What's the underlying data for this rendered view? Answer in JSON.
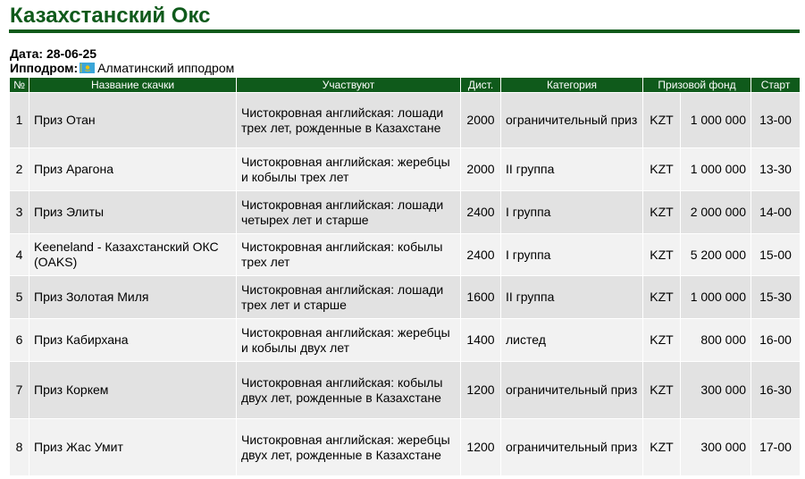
{
  "page": {
    "title": "Казахстанский Окс",
    "date_label": "Дата:",
    "date_value": "28-06-25",
    "hippodrome_label": "Ипподром:",
    "hippodrome_value": "Алматинский ипподром",
    "hippodrome_flag_icon": "kazakhstan-flag-icon",
    "colors": {
      "accent": "#0f5a1b",
      "row_odd": "#e2e2e2",
      "row_even": "#f2f2f2",
      "flag_blue": "#3ba6d8",
      "flag_gold": "#f2c200"
    }
  },
  "table": {
    "headers": {
      "num": "№",
      "name": "Название скачки",
      "participants": "Участвуют",
      "distance": "Дист.",
      "category": "Категория",
      "prize": "Призовой фонд",
      "start": "Старт"
    },
    "rows": [
      {
        "num": "1",
        "name": "Приз Отан",
        "participants": "Чистокровная английская: лошади трех лет, рожденные в Казахстане",
        "distance": "2000",
        "category": "ограничительный приз",
        "currency": "KZT",
        "prize": "1 000 000",
        "start": "13-00"
      },
      {
        "num": "2",
        "name": "Приз Арагона",
        "participants": "Чистокровная английская: жеребцы и кобылы трех лет",
        "distance": "2000",
        "category": "II группа",
        "currency": "KZT",
        "prize": "1 000 000",
        "start": "13-30"
      },
      {
        "num": "3",
        "name": "Приз Элиты",
        "participants": "Чистокровная английская: лошади четырех лет и старше",
        "distance": "2400",
        "category": "I группа",
        "currency": "KZT",
        "prize": "2 000 000",
        "start": "14-00"
      },
      {
        "num": "4",
        "name": "Keeneland - Казахстанский ОКС (OAKS)",
        "participants": "Чистокровная английская: кобылы трех лет",
        "distance": "2400",
        "category": "I группа",
        "currency": "KZT",
        "prize": "5 200 000",
        "start": "15-00"
      },
      {
        "num": "5",
        "name": "Приз Золотая Миля",
        "participants": "Чистокровная английская: лошади трех лет и старше",
        "distance": "1600",
        "category": "II группа",
        "currency": "KZT",
        "prize": "1 000 000",
        "start": "15-30"
      },
      {
        "num": "6",
        "name": "Приз Кабирхана",
        "participants": "Чистокровная английская: жеребцы и кобылы двух лет",
        "distance": "1400",
        "category": "листед",
        "currency": "KZT",
        "prize": "800 000",
        "start": "16-00"
      },
      {
        "num": "7",
        "name": "Приз Коркем",
        "participants": "Чистокровная английская: кобылы двух лет, рожденные в Казахстане",
        "distance": "1200",
        "category": "ограничительный приз",
        "currency": "KZT",
        "prize": "300 000",
        "start": "16-30"
      },
      {
        "num": "8",
        "name": "Приз Жас Умит",
        "participants": "Чистокровная английская: жеребцы двух лет, рожденные в Казахстане",
        "distance": "1200",
        "category": "ограничительный приз",
        "currency": "KZT",
        "prize": "300 000",
        "start": "17-00"
      }
    ]
  }
}
